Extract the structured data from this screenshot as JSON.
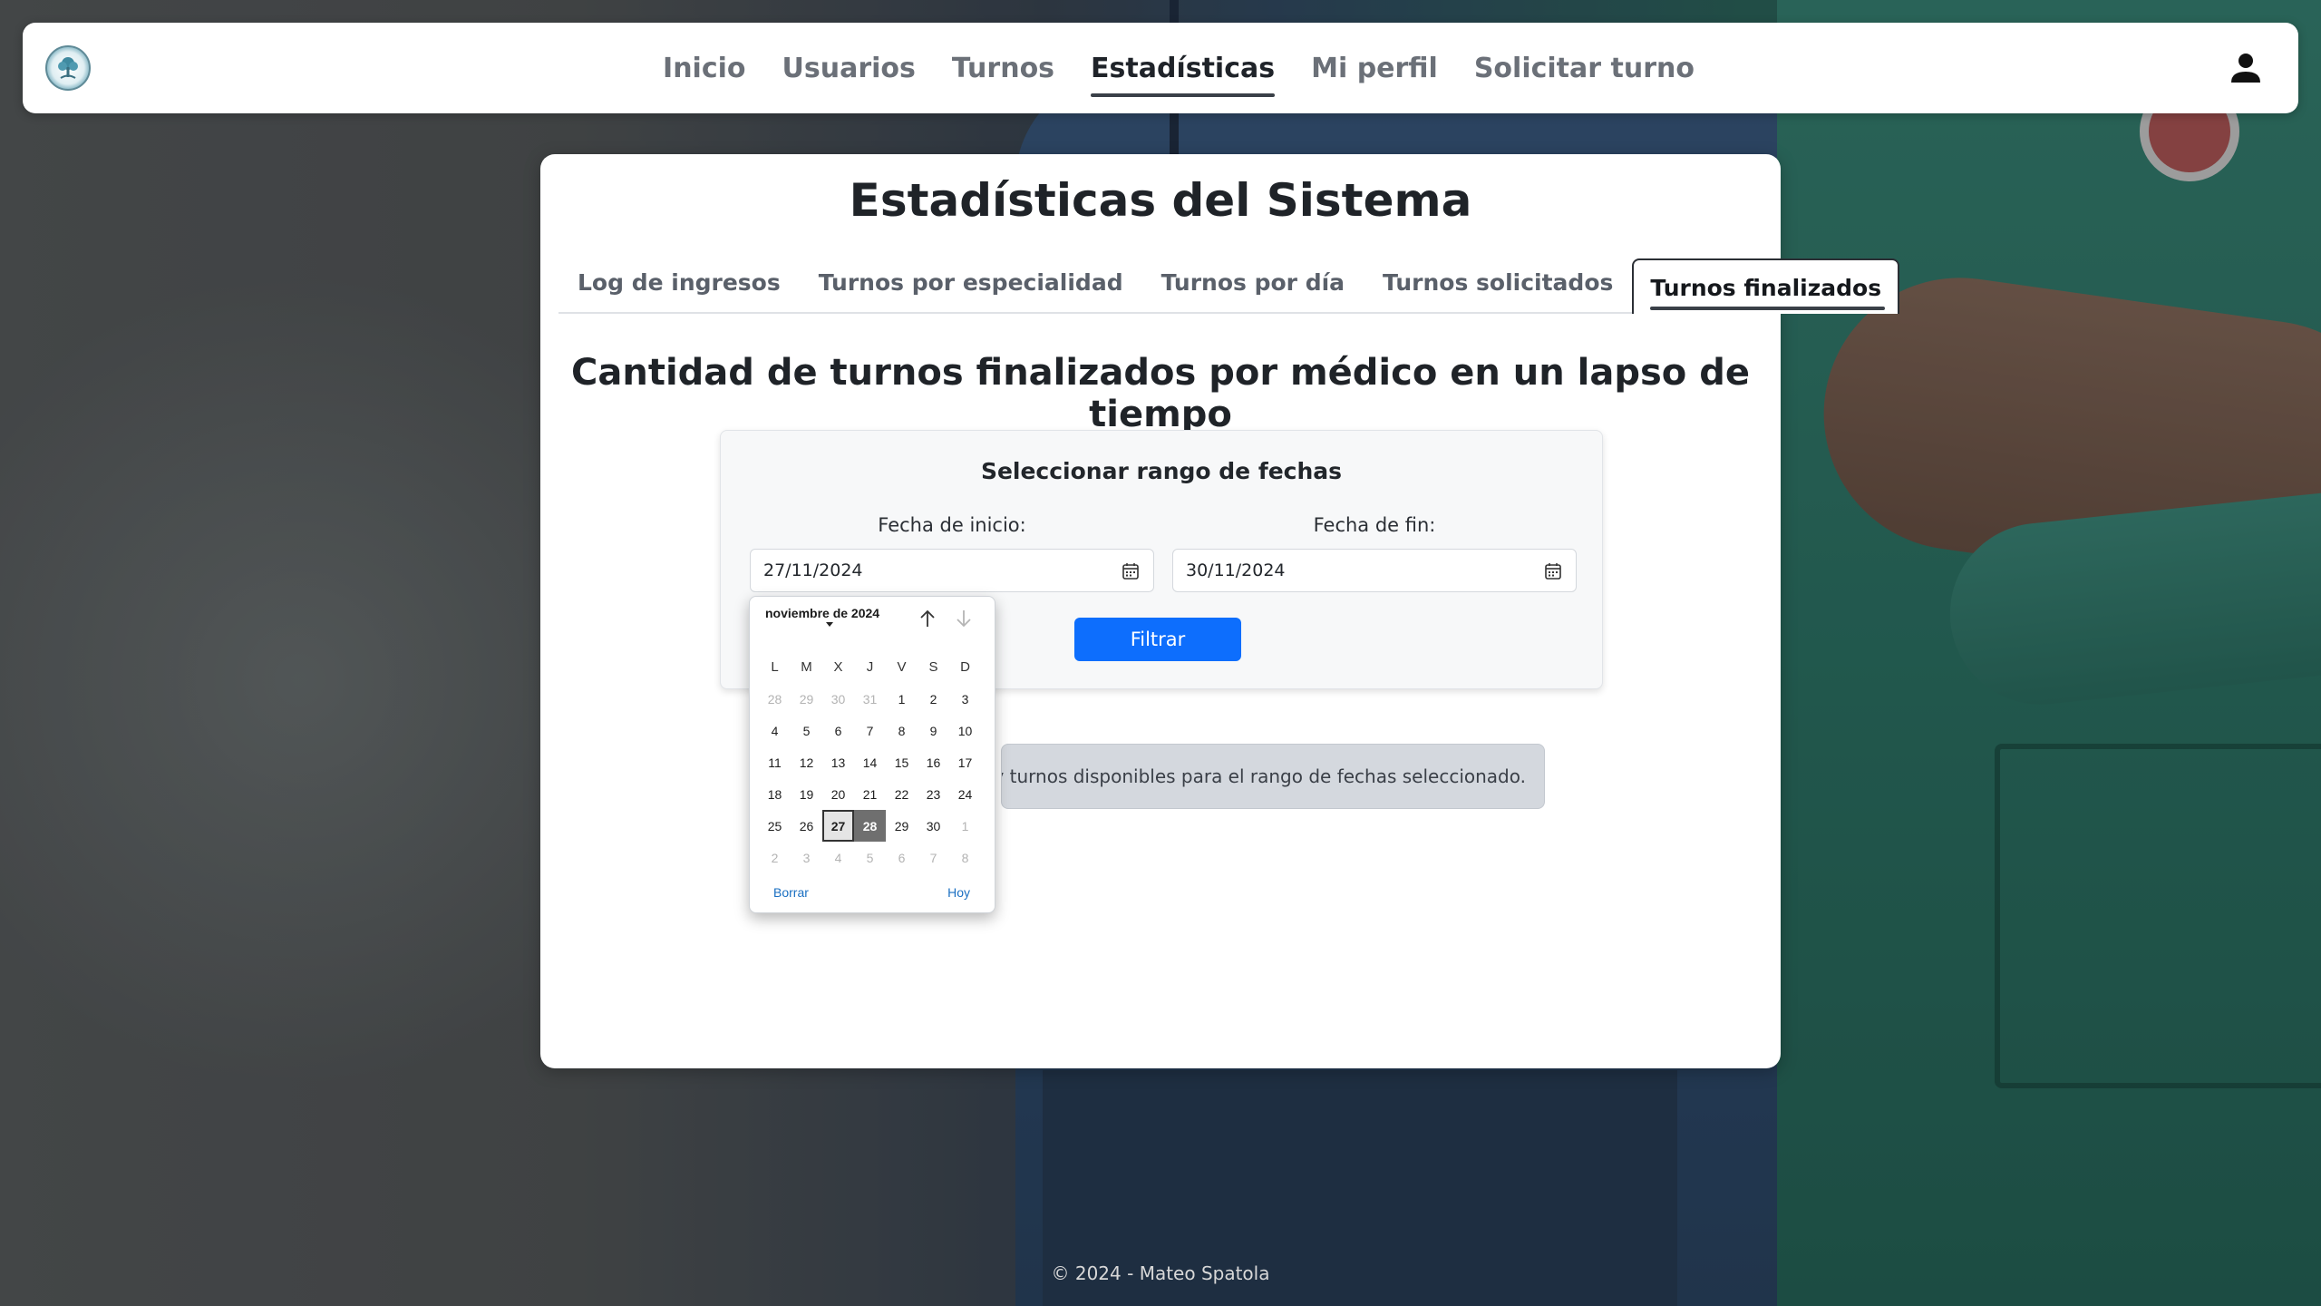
{
  "nav": {
    "links": [
      "Inicio",
      "Usuarios",
      "Turnos",
      "Estadísticas",
      "Mi perfil",
      "Solicitar turno"
    ],
    "active": "Estadísticas"
  },
  "page": {
    "title": "Estadísticas del Sistema",
    "tabs": [
      "Log de ingresos",
      "Turnos por especialidad",
      "Turnos por día",
      "Turnos solicitados",
      "Turnos finalizados"
    ],
    "active_tab": "Turnos finalizados",
    "section_title": "Cantidad de turnos finalizados por médico en un lapso de tiempo"
  },
  "range": {
    "title": "Seleccionar rango de fechas",
    "start_label": "Fecha de inicio:",
    "start_value": "27/11/2024",
    "end_label": "Fecha de fin:",
    "end_value": "30/11/2024",
    "filter_label": "Filtrar"
  },
  "message": {
    "no_data": "No hay turnos disponibles para el rango de fechas seleccionado."
  },
  "calendar": {
    "month_label": "noviembre de 2024",
    "weekdays": [
      "L",
      "M",
      "X",
      "J",
      "V",
      "S",
      "D"
    ],
    "weeks": [
      [
        "28",
        "29",
        "30",
        "31",
        "1",
        "2",
        "3"
      ],
      [
        "4",
        "5",
        "6",
        "7",
        "8",
        "9",
        "10"
      ],
      [
        "11",
        "12",
        "13",
        "14",
        "15",
        "16",
        "17"
      ],
      [
        "18",
        "19",
        "20",
        "21",
        "22",
        "23",
        "24"
      ],
      [
        "25",
        "26",
        "27",
        "28",
        "29",
        "30",
        "1"
      ],
      [
        "2",
        "3",
        "4",
        "5",
        "6",
        "7",
        "8"
      ]
    ],
    "clear_label": "Borrar",
    "today_label": "Hoy"
  },
  "footer": {
    "text": "© 2024 - Mateo Spatola"
  },
  "colors": {
    "primary": "#0d6efd",
    "link": "#1a6fc2"
  }
}
